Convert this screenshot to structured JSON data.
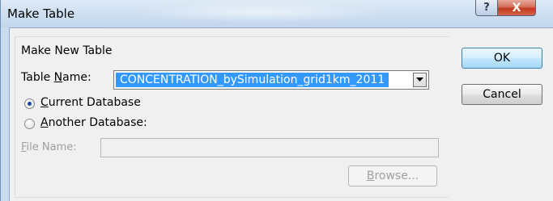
{
  "window": {
    "title": "Make Table",
    "help_glyph": "?",
    "close_glyph": "X"
  },
  "group": {
    "label": "Make New Table"
  },
  "table_name": {
    "label_pre": "Table ",
    "label_accel": "N",
    "label_post": "ame:",
    "value": "CONCENTRATION_bySimulation_grid1km_2011"
  },
  "destination": {
    "current": {
      "accel": "C",
      "rest": "urrent Database",
      "selected": true
    },
    "another": {
      "accel": "A",
      "rest": "nother Database:",
      "selected": false
    }
  },
  "file_name": {
    "accel": "F",
    "rest": "ile Name:",
    "value": ""
  },
  "buttons": {
    "ok": "OK",
    "cancel": "Cancel",
    "browse_accel": "B",
    "browse_rest": "rowse..."
  },
  "icons": {
    "combo_arrow": "chevron-down-icon",
    "help": "help-icon",
    "close": "close-icon"
  }
}
